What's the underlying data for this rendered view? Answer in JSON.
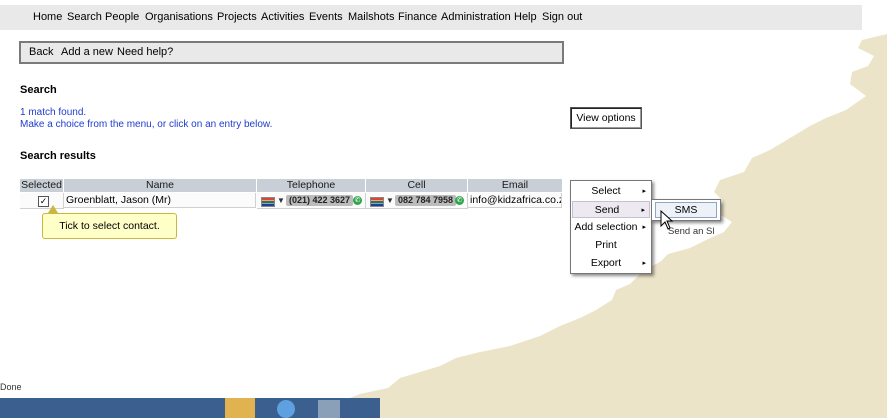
{
  "nav": {
    "items": [
      "Home",
      "Search",
      "People",
      "Organisations",
      "Projects",
      "Activities",
      "Events",
      "Mailshots",
      "Finance",
      "Administration",
      "Help",
      "Sign out"
    ]
  },
  "toolbar": {
    "back_label": "Back",
    "add_label": "Add a new",
    "help_label": "Need help?"
  },
  "search": {
    "heading": "Search",
    "match_text": "1 match found.",
    "instruction_text": "Make a choice from the menu, or click on an entry below.",
    "view_options_label": "View options"
  },
  "results": {
    "heading": "Search results",
    "columns": [
      "Selected",
      "Name",
      "Telephone",
      "Cell",
      "Email"
    ],
    "rows": [
      {
        "selected": "✓",
        "name": "Groenblatt, Jason (Mr)",
        "telephone": "(021) 422 3627",
        "cell": "082 784 7958",
        "email": "info@kidzafrica.co.za"
      }
    ]
  },
  "tooltip": {
    "text": "Tick to select contact."
  },
  "context_menu": {
    "items": [
      {
        "label": "Select",
        "arrow": "▸"
      },
      {
        "label": "Send",
        "arrow": "▸"
      },
      {
        "label": "Add selection",
        "arrow": "▸"
      },
      {
        "label": "Print",
        "arrow": ""
      },
      {
        "label": "Export",
        "arrow": "▸"
      }
    ],
    "submenu_label": "SMS",
    "hint_text": "Send an SMS"
  },
  "status_text": "Done",
  "icons": [
    "flag-icon",
    "call-icon",
    "cursor-icon",
    "checkbox-check-icon"
  ],
  "colors": {
    "link_blue": "#1f3ccf",
    "header_bg": "#c9cfd6",
    "tooltip_bg": "#ffffc8",
    "call_green": "#2da54a"
  }
}
